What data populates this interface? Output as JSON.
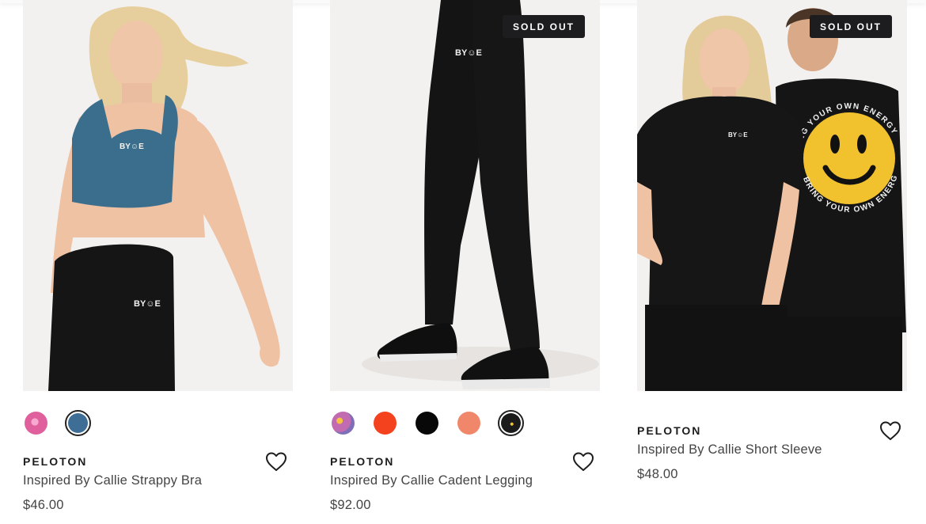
{
  "products": [
    {
      "brand": "PELOTON",
      "name": "Inspired By Callie Strappy Bra",
      "price": "$46.00",
      "sold_out": false,
      "print_logo": "BY☺E",
      "swatches": [
        {
          "color": "#e0609e",
          "pattern": "pink-print",
          "selected": false
        },
        {
          "color": "#3e6d95",
          "pattern": "solid",
          "selected": true
        }
      ]
    },
    {
      "brand": "PELOTON",
      "name": "Inspired By Callie Cadent Legging",
      "price": "$92.00",
      "sold_out": true,
      "badge": "SOLD OUT",
      "print_logo": "BY☺E",
      "swatches": [
        {
          "color": "#c26bb0",
          "pattern": "floral",
          "selected": false
        },
        {
          "color": "#f4411e",
          "pattern": "solid",
          "selected": false
        },
        {
          "color": "#080808",
          "pattern": "solid",
          "selected": false
        },
        {
          "color": "#f1876a",
          "pattern": "solid",
          "selected": false
        },
        {
          "color": "#1b1b1b",
          "pattern": "logo-print",
          "selected": true
        }
      ]
    },
    {
      "brand": "PELOTON",
      "name": "Inspired By Callie Short Sleeve",
      "price": "$48.00",
      "sold_out": true,
      "badge": "SOLD OUT",
      "print_logo": "BY☺E",
      "back_print_top": "BRING YOUR OWN ENERGY",
      "back_print_bottom": "BRING YOUR OWN ENERGY",
      "swatches": []
    }
  ],
  "icons": {
    "wishlist": "heart-outline-icon"
  },
  "colors": {
    "badge_bg": "#1d1d1f",
    "image_bg": "#f3f1ef",
    "text_dark": "#1d1d1f",
    "text_body": "#444444",
    "smiley_yellow": "#f2c12e"
  }
}
